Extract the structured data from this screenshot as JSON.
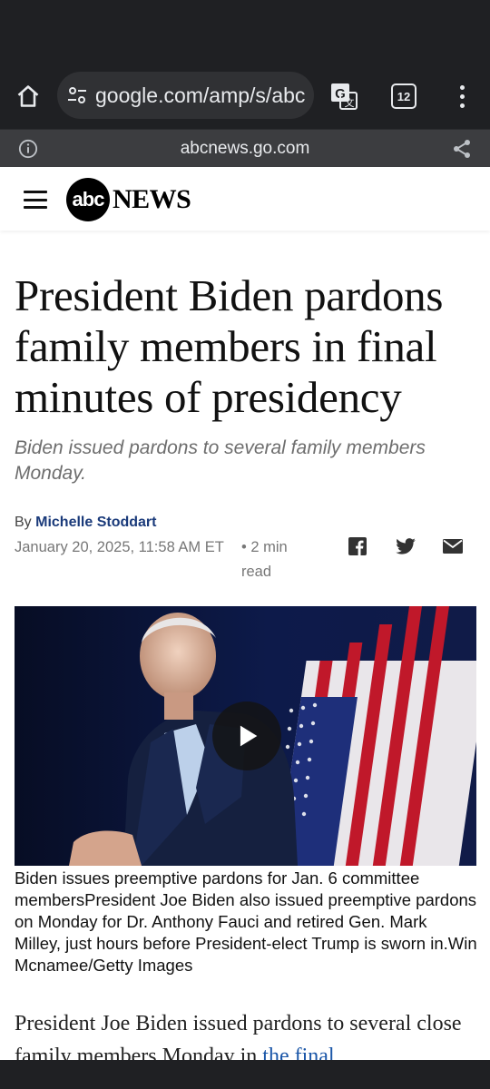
{
  "browser": {
    "url": "google.com/amp/s/abc",
    "tab_count": "12",
    "amp_domain": "abcnews.go.com"
  },
  "site": {
    "logo_text": "abc",
    "brand": "NEWS"
  },
  "article": {
    "headline": "President Biden pardons family members in final minutes of presidency",
    "subheadline": "Biden issued pardons to several family members Monday.",
    "by_prefix": "By",
    "author": "Michelle Stoddart",
    "date": "January 20, 2025, 11:58 AM ET",
    "read_time": "• 2 min read",
    "image_caption": "Biden issues preemptive pardons for Jan. 6 committee membersPresident Joe Biden also issued preemptive pardons on Monday for Dr. Anthony Fauci and retired Gen. Mark Milley, just hours before President-elect Trump is sworn in.Win Mcnamee/Getty Images",
    "body_start": "President Joe Biden issued pardons to several close family members Monday in ",
    "body_link": "the final"
  },
  "icons": {
    "home": "home-icon",
    "tune": "site-settings-icon",
    "translate": "translate-icon",
    "menu": "more-vert-icon",
    "info": "info-icon",
    "share": "share-icon",
    "hamburger": "hamburger-menu-icon",
    "facebook": "facebook-icon",
    "twitter": "twitter-icon",
    "email": "email-icon",
    "play": "play-icon"
  },
  "colors": {
    "chrome_dark": "#1f2023",
    "amp_bar": "#3c3d40",
    "author_link": "#1a3a7a",
    "body_link": "#1a56a8"
  }
}
